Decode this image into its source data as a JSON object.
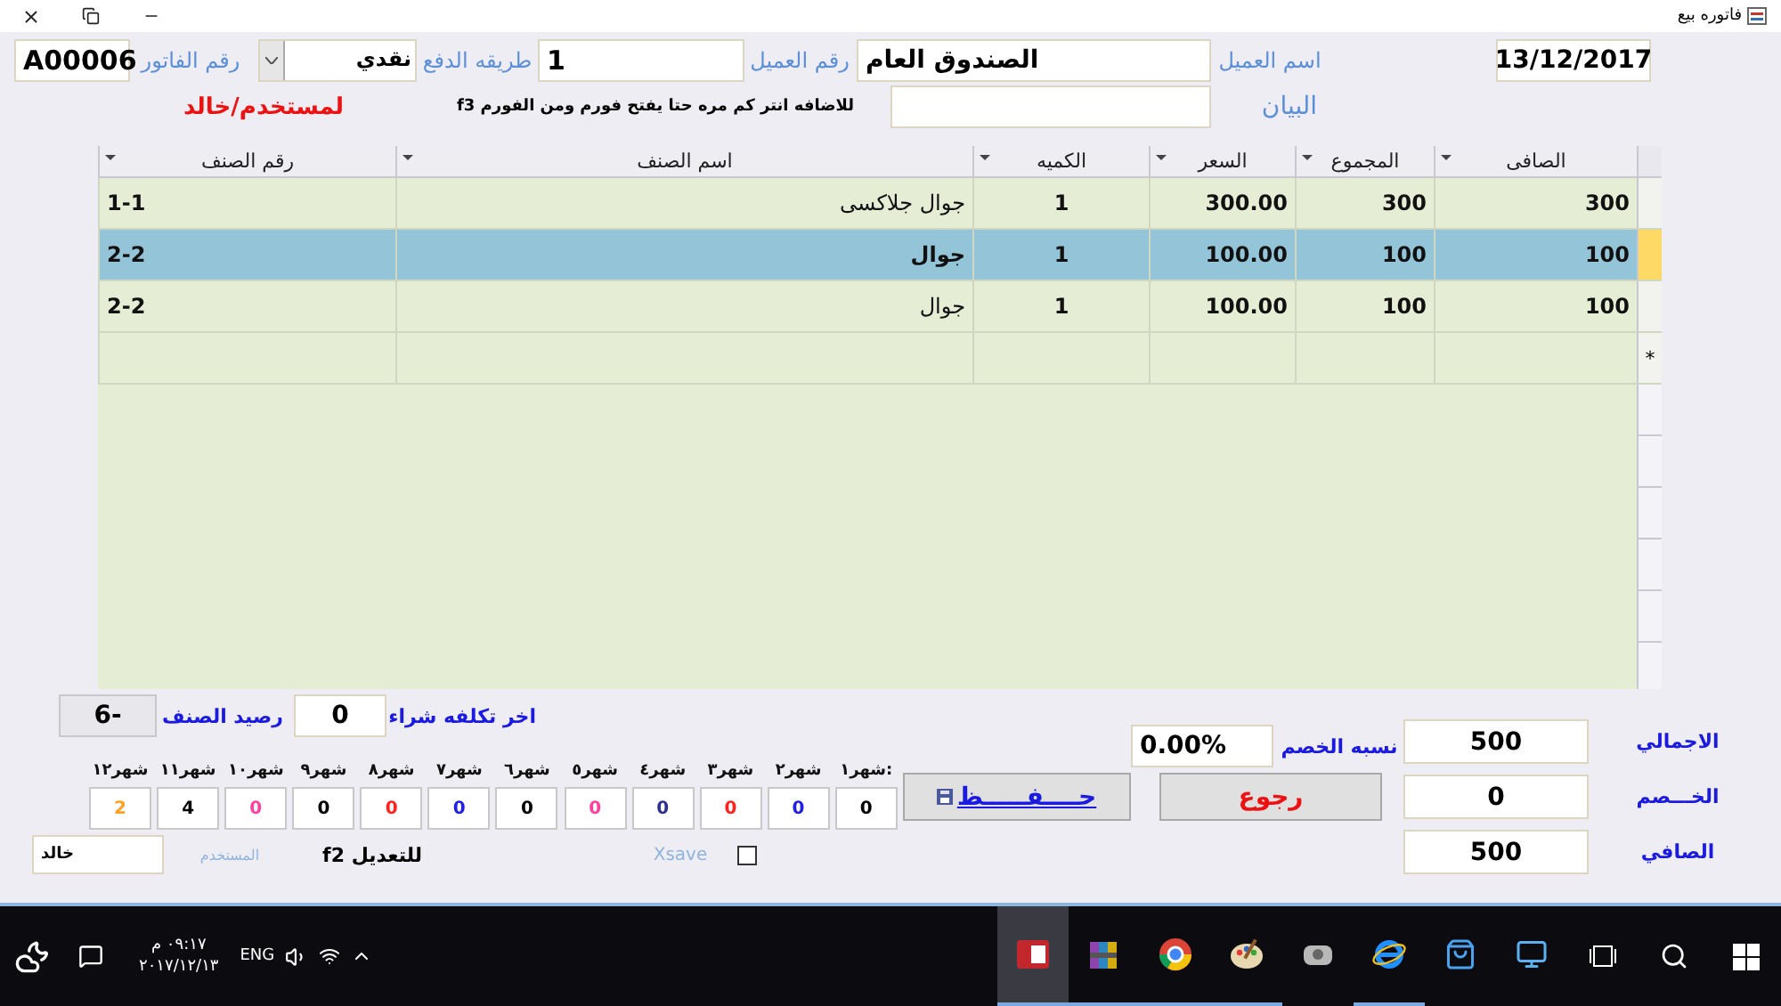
{
  "window": {
    "title": "فاتوره بيع"
  },
  "header": {
    "invoice_label": "رقم الفاتور",
    "invoice_no": "A00006",
    "payment_label": "طريقه الدفع",
    "payment_value": "نقدي",
    "customer_no_label": "رقم العميل",
    "customer_no": "1",
    "customer_name_label": "اسم العميل",
    "customer_name": "الصندوق العام",
    "date": "13/12/2017",
    "user_note": "لمستخدم/خالد",
    "hint": "للاضافه انتر كم مره حتا يفتح فورم ومن الفورم f3",
    "statement_label": "البيان"
  },
  "table": {
    "columns": [
      "الصافى",
      "المجموع",
      "السعر",
      "الكميه",
      "اسم الصنف",
      "رقم الصنف"
    ],
    "rows": [
      {
        "selected": false,
        "cells": [
          "300",
          "300",
          "300.00",
          "1",
          "جوال جلاكسى",
          "1-1"
        ]
      },
      {
        "selected": true,
        "cells": [
          "100",
          "100",
          "100.00",
          "1",
          "جوال",
          "2-2"
        ]
      },
      {
        "selected": false,
        "cells": [
          "100",
          "100",
          "100.00",
          "1",
          "جوال",
          "2-2"
        ]
      }
    ],
    "new_row_marker": "*"
  },
  "stock": {
    "balance_label": "رصيد الصنف",
    "balance": "-6",
    "last_cost_label": "اخر تكلفه شراء",
    "last_cost": "0"
  },
  "months": [
    {
      "label": "شهر١:",
      "value": "0",
      "color": "#000000"
    },
    {
      "label": "شهر٢",
      "value": "0",
      "color": "#2020e0"
    },
    {
      "label": "شهر٣",
      "value": "0",
      "color": "#ff2020"
    },
    {
      "label": "شهر٤",
      "value": "0",
      "color": "#303090"
    },
    {
      "label": "شهر٥",
      "value": "0",
      "color": "#ff40a0"
    },
    {
      "label": "شهر٦",
      "value": "0",
      "color": "#000000"
    },
    {
      "label": "شهر٧",
      "value": "0",
      "color": "#2020e0"
    },
    {
      "label": "شهر٨",
      "value": "0",
      "color": "#ff2020"
    },
    {
      "label": "شهر٩",
      "value": "0",
      "color": "#000000"
    },
    {
      "label": "شهر١٠",
      "value": "0",
      "color": "#ff40a0"
    },
    {
      "label": "شهر١١",
      "value": "4",
      "color": "#000000"
    },
    {
      "label": "شهر١٢",
      "value": "2",
      "color": "#ffa020"
    }
  ],
  "user": {
    "value": "خالد",
    "label": "المستخدم"
  },
  "edit_hint": "للتعديل f2",
  "xsave": {
    "label": "Xsave",
    "checked": false
  },
  "buttons": {
    "save": "حــــفـــــظ",
    "back": "رجوع"
  },
  "totals": {
    "discount_rate_label": "نسبه الخصم",
    "discount_rate": "0.00%",
    "total_label": "الاجمالي",
    "total": "500",
    "discount_label": "الخـــصم",
    "discount": "0",
    "net_label": "الصافي",
    "net": "500"
  },
  "taskbar": {
    "time": "٠٩:١٧ م",
    "date": "٢٠١٧/١٢/١٣",
    "language": "ENG",
    "apps": [
      {
        "kind": "access",
        "selected": true,
        "running": true
      },
      {
        "kind": "books",
        "selected": false,
        "running": true
      },
      {
        "kind": "browser",
        "selected": false,
        "running": true
      },
      {
        "kind": "palette",
        "selected": false,
        "running": true
      },
      {
        "kind": "drive",
        "selected": false,
        "running": false
      },
      {
        "kind": "orbit",
        "selected": false,
        "running": true
      },
      {
        "kind": "store",
        "selected": false,
        "running": false
      },
      {
        "kind": "monitor",
        "selected": false,
        "running": false
      }
    ]
  }
}
